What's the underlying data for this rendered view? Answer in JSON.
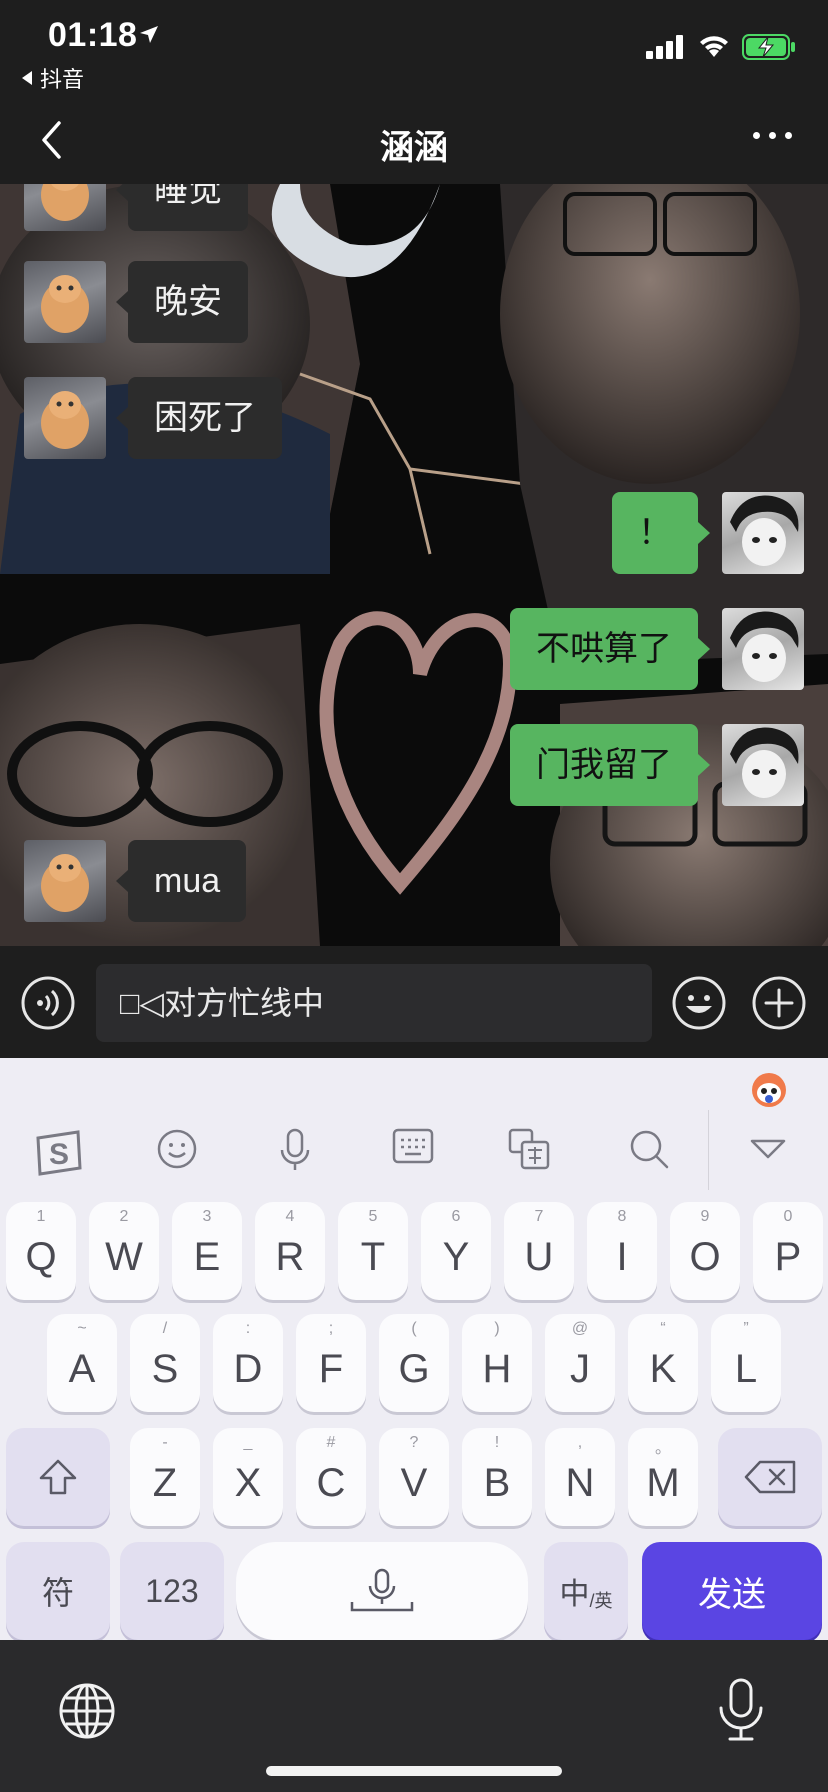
{
  "status_bar": {
    "time": "01:18",
    "back_app": "抖音"
  },
  "nav": {
    "title": "涵涵"
  },
  "messages": [
    {
      "side": "in",
      "text": "睡觉"
    },
    {
      "side": "in",
      "text": "晚安"
    },
    {
      "side": "in",
      "text": "困死了"
    },
    {
      "side": "out",
      "text": "！"
    },
    {
      "side": "out",
      "text": "不哄算了"
    },
    {
      "side": "out",
      "text": "门我留了"
    },
    {
      "side": "in",
      "text": "mua"
    }
  ],
  "input": {
    "value": "□◁对方忙线中"
  },
  "keyboard": {
    "row1": [
      {
        "main": "Q",
        "sub": "1"
      },
      {
        "main": "W",
        "sub": "2"
      },
      {
        "main": "E",
        "sub": "3"
      },
      {
        "main": "R",
        "sub": "4"
      },
      {
        "main": "T",
        "sub": "5"
      },
      {
        "main": "Y",
        "sub": "6"
      },
      {
        "main": "U",
        "sub": "7"
      },
      {
        "main": "I",
        "sub": "8"
      },
      {
        "main": "O",
        "sub": "9"
      },
      {
        "main": "P",
        "sub": "0"
      }
    ],
    "row2": [
      {
        "main": "A",
        "sub": "~"
      },
      {
        "main": "S",
        "sub": "/"
      },
      {
        "main": "D",
        "sub": ":"
      },
      {
        "main": "F",
        "sub": ";"
      },
      {
        "main": "G",
        "sub": "("
      },
      {
        "main": "H",
        "sub": ")"
      },
      {
        "main": "J",
        "sub": "@"
      },
      {
        "main": "K",
        "sub": "“"
      },
      {
        "main": "L",
        "sub": "”"
      }
    ],
    "row3": [
      {
        "main": "Z",
        "sub": "-"
      },
      {
        "main": "X",
        "sub": "_"
      },
      {
        "main": "C",
        "sub": "#"
      },
      {
        "main": "V",
        "sub": "?"
      },
      {
        "main": "B",
        "sub": "!"
      },
      {
        "main": "N",
        "sub": ","
      },
      {
        "main": "M",
        "sub": "。"
      }
    ],
    "symbols_key": "符",
    "numbers_key": "123",
    "lang_key_main": "中",
    "lang_key_sub": "/英",
    "send_key": "发送"
  },
  "colors": {
    "bubble_out": "#57b560",
    "bubble_in": "#2c2c2c",
    "send_key": "#5a45e3"
  }
}
